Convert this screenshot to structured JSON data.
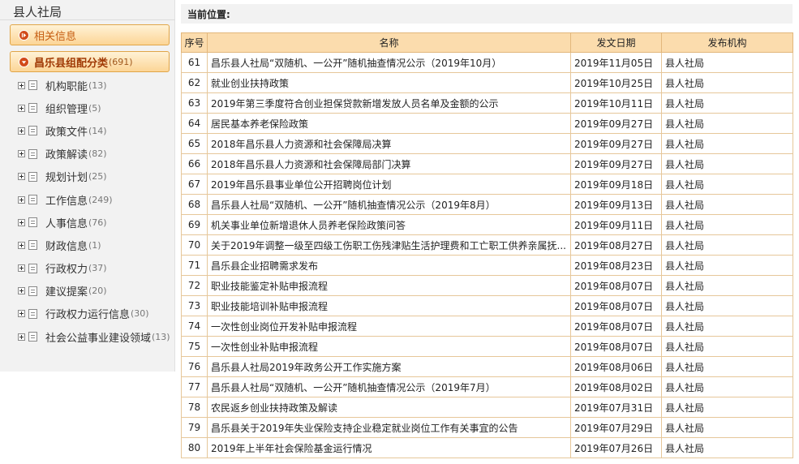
{
  "sidebar": {
    "title": "县人社局",
    "info_button": {
      "label": "相关信息"
    },
    "group_button": {
      "label": "昌乐县组配分类",
      "count": "(691)"
    },
    "tree": [
      {
        "label": "机构职能",
        "count": "(13)"
      },
      {
        "label": "组织管理",
        "count": "(5)"
      },
      {
        "label": "政策文件",
        "count": "(14)"
      },
      {
        "label": "政策解读",
        "count": "(82)"
      },
      {
        "label": "规划计划",
        "count": "(25)"
      },
      {
        "label": "工作信息",
        "count": "(249)"
      },
      {
        "label": "人事信息",
        "count": "(76)"
      },
      {
        "label": "财政信息",
        "count": "(1)"
      },
      {
        "label": "行政权力",
        "count": "(37)"
      },
      {
        "label": "建议提案",
        "count": "(20)"
      },
      {
        "label": "行政权力运行信息",
        "count": "(30)"
      },
      {
        "label": "社会公益事业建设领域",
        "count": "(13)"
      }
    ]
  },
  "location": {
    "label": "当前位置:"
  },
  "table": {
    "headers": [
      "序号",
      "名称",
      "发文日期",
      "发布机构"
    ],
    "rows": [
      [
        "61",
        "昌乐县人社局“双随机、一公开”随机抽查情况公示（2019年10月）",
        "2019年11月05日",
        "县人社局"
      ],
      [
        "62",
        "就业创业扶持政策",
        "2019年10月25日",
        "县人社局"
      ],
      [
        "63",
        "2019年第三季度符合创业担保贷款新增发放人员名单及金额的公示",
        "2019年10月11日",
        "县人社局"
      ],
      [
        "64",
        "居民基本养老保险政策",
        "2019年09月27日",
        "县人社局"
      ],
      [
        "65",
        "2018年昌乐县人力资源和社会保障局决算",
        "2019年09月27日",
        "县人社局"
      ],
      [
        "66",
        "2018年昌乐县人力资源和社会保障局部门决算",
        "2019年09月27日",
        "县人社局"
      ],
      [
        "67",
        "2019年昌乐县事业单位公开招聘岗位计划",
        "2019年09月18日",
        "县人社局"
      ],
      [
        "68",
        "昌乐县人社局“双随机、一公开”随机抽查情况公示（2019年8月）",
        "2019年09月13日",
        "县人社局"
      ],
      [
        "69",
        "机关事业单位新增退休人员养老保险政策问答",
        "2019年09月11日",
        "县人社局"
      ],
      [
        "70",
        "关于2019年调整一级至四级工伤职工伤残津贴生活护理费和工亡职工供养亲属抚...",
        "2019年08月27日",
        "县人社局"
      ],
      [
        "71",
        "昌乐县企业招聘需求发布",
        "2019年08月23日",
        "县人社局"
      ],
      [
        "72",
        "职业技能鉴定补贴申报流程",
        "2019年08月07日",
        "县人社局"
      ],
      [
        "73",
        "职业技能培训补贴申报流程",
        "2019年08月07日",
        "县人社局"
      ],
      [
        "74",
        "一次性创业岗位开发补贴申报流程",
        "2019年08月07日",
        "县人社局"
      ],
      [
        "75",
        "一次性创业补贴申报流程",
        "2019年08月07日",
        "县人社局"
      ],
      [
        "76",
        "昌乐县人社局2019年政务公开工作实施方案",
        "2019年08月06日",
        "县人社局"
      ],
      [
        "77",
        "昌乐县人社局“双随机、一公开”随机抽查情况公示（2019年7月）",
        "2019年08月02日",
        "县人社局"
      ],
      [
        "78",
        "农民返乡创业扶持政策及解读",
        "2019年07月31日",
        "县人社局"
      ],
      [
        "79",
        "昌乐县关于2019年失业保险支持企业稳定就业岗位工作有关事宜的公告",
        "2019年07月29日",
        "县人社局"
      ],
      [
        "80",
        "2019年上半年社会保险基金运行情况",
        "2019年07月26日",
        "县人社局"
      ]
    ]
  }
}
